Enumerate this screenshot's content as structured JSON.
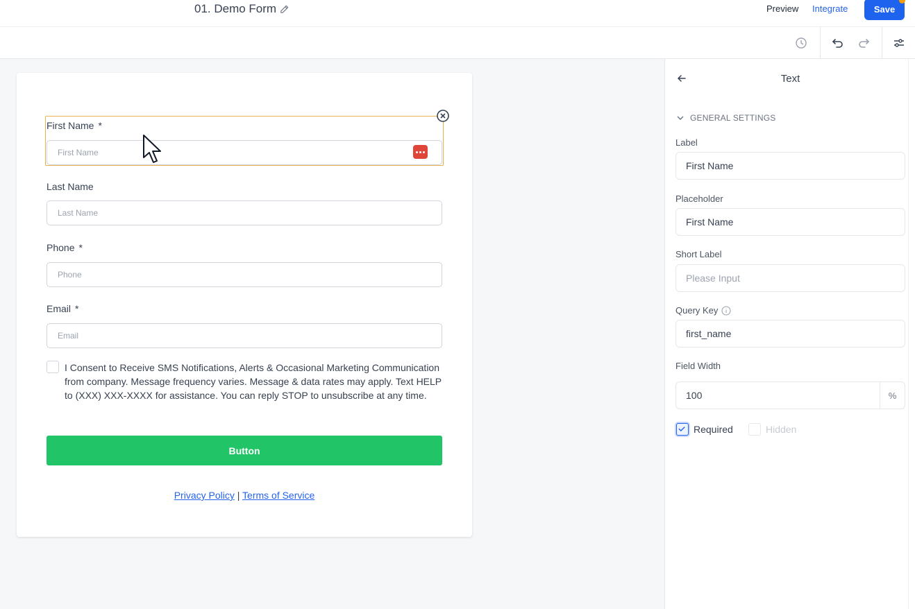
{
  "header": {
    "title": "01. Demo Form",
    "preview_label": "Preview",
    "integrate_label": "Integrate",
    "save_label": "Save"
  },
  "icons": {
    "edit": "pencil-icon",
    "history": "clock-icon",
    "undo": "undo-icon",
    "redo": "redo-icon",
    "settings": "sliders-icon",
    "close": "close-circle-icon",
    "back": "arrow-left-icon",
    "chevron": "chevron-down-icon",
    "info": "info-icon",
    "password_manager": "dots-badge-icon"
  },
  "form": {
    "fields": [
      {
        "label": "First Name",
        "required_mark": "*",
        "placeholder": "First Name"
      },
      {
        "label": "Last Name",
        "required_mark": "",
        "placeholder": "Last Name"
      },
      {
        "label": "Phone",
        "required_mark": "*",
        "placeholder": "Phone"
      },
      {
        "label": "Email",
        "required_mark": "*",
        "placeholder": "Email"
      }
    ],
    "consent_text": "I Consent to Receive SMS Notifications, Alerts & Occasional Marketing Communication from company. Message frequency varies. Message & data rates may apply. Text HELP to (XXX) XXX-XXXX for assistance. You can reply STOP to unsubscribe at any time.",
    "submit_label": "Button",
    "privacy_label": "Privacy Policy",
    "separator": "|",
    "terms_label": "Terms of Service"
  },
  "panel": {
    "title": "Text",
    "section_title": "GENERAL SETTINGS",
    "label_title": "Label",
    "label_value": "First Name",
    "placeholder_title": "Placeholder",
    "placeholder_value": "First Name",
    "short_label_title": "Short Label",
    "short_label_placeholder": "Please Input",
    "query_key_title": "Query Key",
    "query_key_value": "first_name",
    "field_width_title": "Field Width",
    "field_width_value": "100",
    "field_width_unit": "%",
    "required_label": "Required",
    "hidden_label": "Hidden"
  },
  "colors": {
    "accent": "#1d63ed",
    "link": "#2563eb",
    "submit": "#22c468",
    "selection": "#e9b14f",
    "badge": "#e0453a"
  }
}
